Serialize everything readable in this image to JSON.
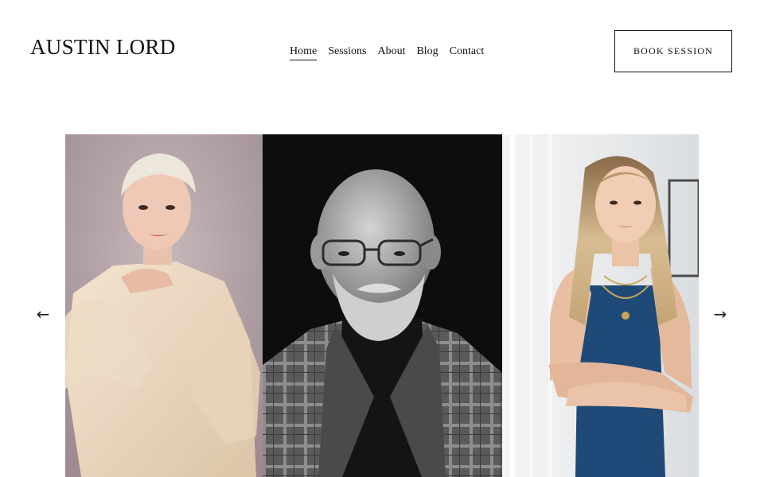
{
  "header": {
    "brand": "AUSTIN LORD",
    "nav": [
      {
        "label": "Home",
        "active": true
      },
      {
        "label": "Sessions",
        "active": false
      },
      {
        "label": "About",
        "active": false
      },
      {
        "label": "Blog",
        "active": false
      },
      {
        "label": "Contact",
        "active": false
      }
    ],
    "cta_label": "BOOK SESSION"
  },
  "gallery": {
    "prev_arrow": "←",
    "next_arrow": "→",
    "slides": [
      {
        "subject": "woman with short platinum hair in sheer cream blouse",
        "tone": "color",
        "background": "#b9a9ae"
      },
      {
        "subject": "older bald man with glasses and white beard in plaid jacket",
        "tone": "black-and-white",
        "background": "#0d0d0d"
      },
      {
        "subject": "woman with long wavy blonde hair in navy dress, arms crossed",
        "tone": "color",
        "background": "#eef0f2"
      }
    ]
  },
  "colors": {
    "text": "#111111",
    "background": "#ffffff"
  }
}
